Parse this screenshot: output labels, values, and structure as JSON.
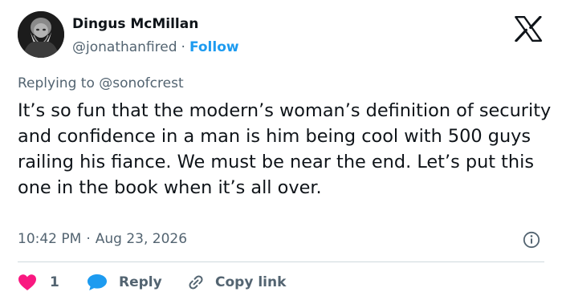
{
  "author": {
    "name": "Dingus McMillan",
    "handle": "@jonathanfired",
    "separator": "·",
    "follow_label": "Follow"
  },
  "reply_context": {
    "prefix": "Replying to",
    "mention": "@sonofcrest"
  },
  "tweet": {
    "text": "It’s so fun that the modern’s woman’s definition of security and confidence in a man is him being cool with 500 guys railing his fiance. We must be near the end. Let’s put this one in the book when it’s all over."
  },
  "meta": {
    "time": "10:42 PM",
    "separator": "·",
    "date": "Aug 23, 2026"
  },
  "actions": {
    "like_count": "1",
    "reply_label": "Reply",
    "copy_link_label": "Copy link"
  },
  "icons": {
    "logo": "x-logo-icon",
    "info": "info-icon",
    "like": "heart-icon",
    "reply": "speech-bubble-icon",
    "copy": "link-icon"
  },
  "colors": {
    "text": "#0f1419",
    "secondary": "#536471",
    "accent": "#1d9bf0",
    "like": "#f91880",
    "divider": "#cfd9de"
  }
}
